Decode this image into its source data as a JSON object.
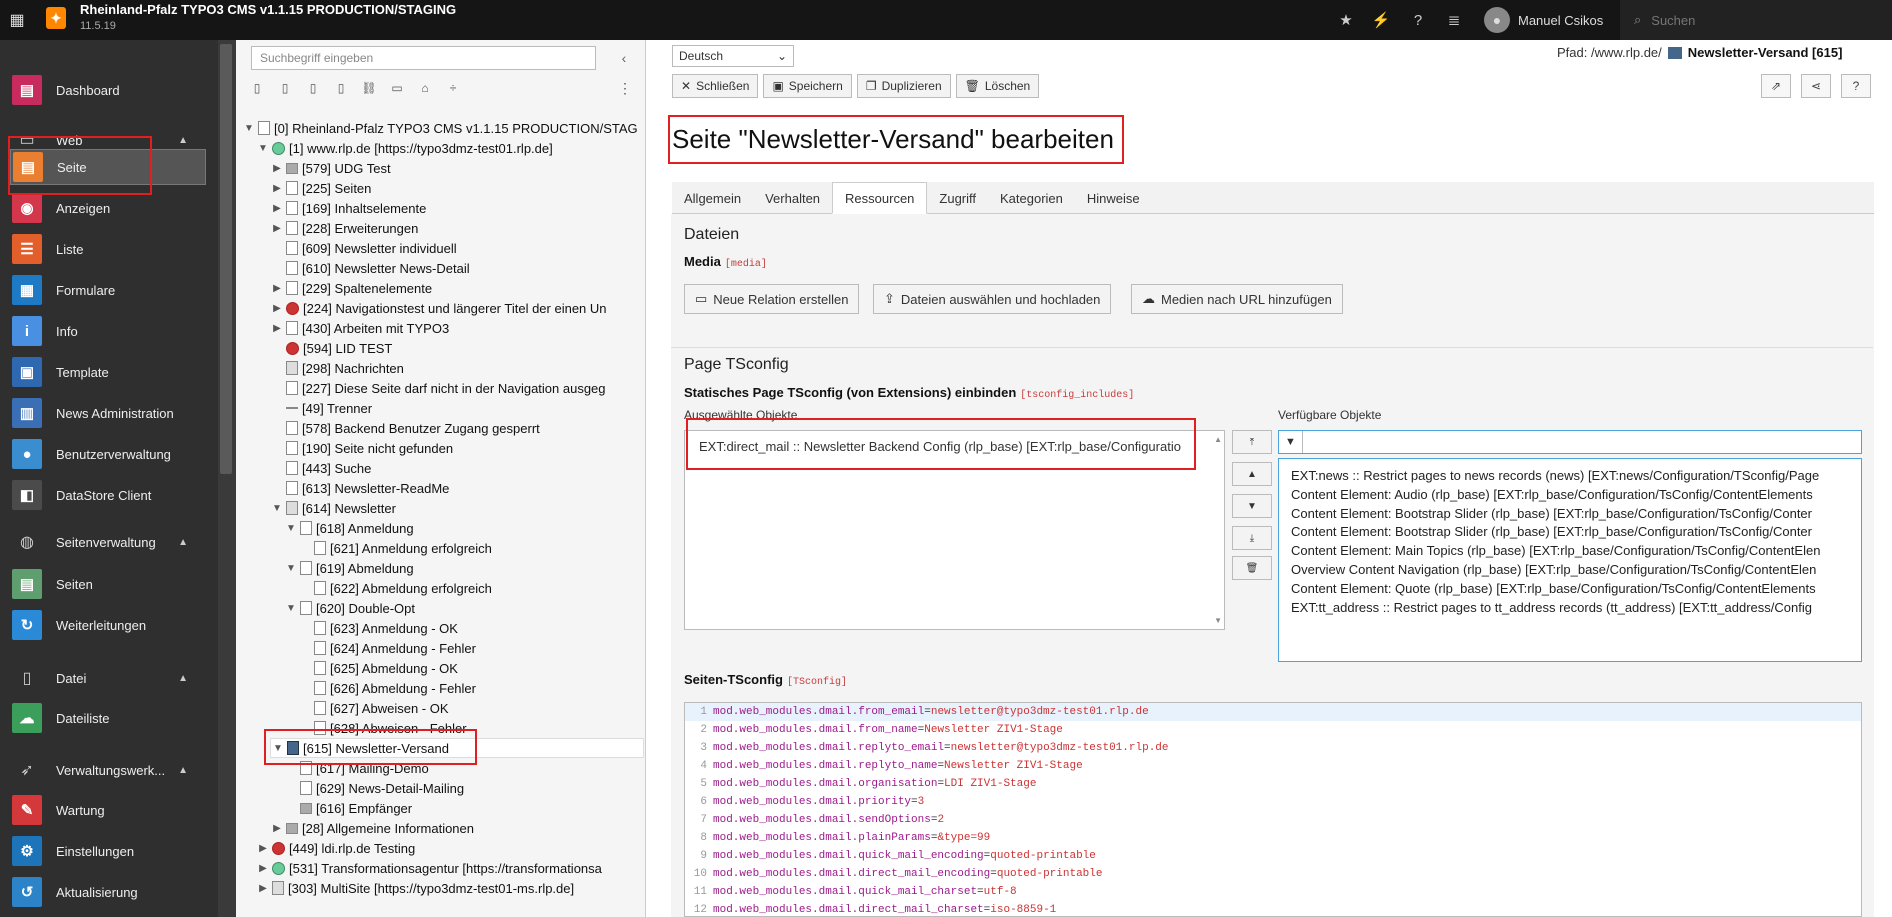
{
  "topbar": {
    "site_name": "Rheinland-Pfalz TYPO3 CMS v1.1.15 PRODUCTION/STAGING",
    "version": "11.5.19",
    "user_name": "Manuel Csikos",
    "search_placeholder": "Suchen"
  },
  "sidebar": {
    "dashboard": "Dashboard",
    "group_web": "Web",
    "web_items": [
      {
        "label": "Seite",
        "color": "#ea7f32",
        "icon": "page-module-icon"
      },
      {
        "label": "Anzeigen",
        "color": "#d4364c",
        "icon": "view-icon"
      },
      {
        "label": "Liste",
        "color": "#e25f2c",
        "icon": "list-icon"
      },
      {
        "label": "Formulare",
        "color": "#1f7ac5",
        "icon": "form-icon"
      },
      {
        "label": "Info",
        "color": "#4a90e2",
        "icon": "info-icon"
      },
      {
        "label": "Template",
        "color": "#2d68b1",
        "icon": "template-icon"
      },
      {
        "label": "News Administration",
        "color": "#3b6fb5",
        "icon": "news-icon"
      },
      {
        "label": "Benutzerverwaltung",
        "color": "#3a8ed0",
        "icon": "user-admin-icon"
      },
      {
        "label": "DataStore Client",
        "color": "#4b4b4b",
        "icon": "datastore-icon"
      }
    ],
    "group_seitenverwaltung": "Seitenverwaltung",
    "seitenverwaltung_items": [
      {
        "label": "Seiten",
        "color": "#5f9e6e",
        "icon": "pages-icon"
      },
      {
        "label": "Weiterleitungen",
        "color": "#2b8ad7",
        "icon": "redirect-icon"
      }
    ],
    "group_datei": "Datei",
    "datei_items": [
      {
        "label": "Dateiliste",
        "color": "#3b9e5a",
        "icon": "filelist-icon"
      }
    ],
    "group_verwaltung": "Verwaltungswerk...",
    "verwaltung_items": [
      {
        "label": "Wartung",
        "color": "#d4383a",
        "icon": "maintenance-icon"
      },
      {
        "label": "Einstellungen",
        "color": "#1e74b8",
        "icon": "settings-icon"
      },
      {
        "label": "Aktualisierung",
        "color": "#2c83c8",
        "icon": "upgrade-icon"
      }
    ]
  },
  "tree": {
    "search_placeholder": "Suchbegriff eingeben",
    "nodes": [
      {
        "label": "[0] Rheinland-Pfalz TYPO3 CMS v1.1.15 PRODUCTION/STAG",
        "arrow": "▼",
        "icon": "root"
      },
      {
        "label": "[1] www.rlp.de [https://typo3dmz-test01.rlp.de]",
        "arrow": "▼",
        "icon": "glob"
      },
      {
        "label": "[579] UDG Test",
        "arrow": "▶",
        "icon": "fold"
      },
      {
        "label": "[225] Seiten",
        "arrow": "▶",
        "icon": "page"
      },
      {
        "label": "[169] Inhaltselemente",
        "arrow": "▶",
        "icon": "page"
      },
      {
        "label": "[228] Erweiterungen",
        "arrow": "▶",
        "icon": "page"
      },
      {
        "label": "[609] Newsletter individuell",
        "arrow": "",
        "icon": "page"
      },
      {
        "label": "[610] Newsletter News-Detail",
        "arrow": "",
        "icon": "page"
      },
      {
        "label": "[229] Spaltenelemente",
        "arrow": "▶",
        "icon": "page"
      },
      {
        "label": "[224] Navigationstest und längerer Titel der einen Un",
        "arrow": "▶",
        "icon": "red"
      },
      {
        "label": "[430] Arbeiten mit TYPO3",
        "arrow": "▶",
        "icon": "page"
      },
      {
        "label": "[594] LID TEST",
        "arrow": "",
        "icon": "red"
      },
      {
        "label": "[298] Nachrichten",
        "arrow": "",
        "icon": "home"
      },
      {
        "label": "[227] Diese Seite darf nicht in der Navigation ausgeg",
        "arrow": "",
        "icon": "page"
      },
      {
        "label": "[49] Trenner",
        "arrow": "",
        "icon": "sep"
      },
      {
        "label": "[578] Backend Benutzer Zugang gesperrt",
        "arrow": "",
        "icon": "page"
      },
      {
        "label": "[190] Seite nicht gefunden",
        "arrow": "",
        "icon": "page"
      },
      {
        "label": "[443] Suche",
        "arrow": "",
        "icon": "page"
      },
      {
        "label": "[613] Newsletter-ReadMe",
        "arrow": "",
        "icon": "page"
      },
      {
        "label": "[614] Newsletter",
        "arrow": "▼",
        "icon": "home"
      },
      {
        "label": "[618] Anmeldung",
        "arrow": "▼",
        "icon": "page"
      },
      {
        "label": "[621] Anmeldung erfolgreich",
        "arrow": "",
        "icon": "page"
      },
      {
        "label": "[619] Abmeldung",
        "arrow": "▼",
        "icon": "page"
      },
      {
        "label": "[622] Abmeldung erfolgreich",
        "arrow": "",
        "icon": "page"
      },
      {
        "label": "[620] Double-Opt",
        "arrow": "▼",
        "icon": "page"
      },
      {
        "label": "[623] Anmeldung - OK",
        "arrow": "",
        "icon": "page"
      },
      {
        "label": "[624] Anmeldung - Fehler",
        "arrow": "",
        "icon": "page"
      },
      {
        "label": "[625] Abmeldung - OK",
        "arrow": "",
        "icon": "page"
      },
      {
        "label": "[626] Abmeldung - Fehler",
        "arrow": "",
        "icon": "page"
      },
      {
        "label": "[627] Abweisen - OK",
        "arrow": "",
        "icon": "page"
      },
      {
        "label": "[628] Abweisen - Fehler",
        "arrow": "",
        "icon": "page"
      },
      {
        "label": "[615] Newsletter-Versand",
        "arrow": "▼",
        "icon": "mail"
      },
      {
        "label": "[617] Mailing-Demo",
        "arrow": "",
        "icon": "page"
      },
      {
        "label": "[629] News-Detail-Mailing",
        "arrow": "",
        "icon": "page"
      },
      {
        "label": "[616] Empfänger",
        "arrow": "",
        "icon": "fold"
      },
      {
        "label": "[28] Allgemeine Informationen",
        "arrow": "▶",
        "icon": "fold"
      },
      {
        "label": "[449] ldi.rlp.de Testing",
        "arrow": "▶",
        "icon": "red"
      },
      {
        "label": "[531] Transformationsagentur [https://transformationsa",
        "arrow": "▶",
        "icon": "glob"
      },
      {
        "label": "[303] MultiSite [https://typo3dmz-test01-ms.rlp.de]",
        "arrow": "▶",
        "icon": "home"
      }
    ]
  },
  "doc": {
    "language": "Deutsch",
    "path_label": "Pfad: /www.rlp.de/",
    "path_page": "Newsletter-Versand [615]",
    "btn_close": "Schließen",
    "btn_save": "Speichern",
    "btn_duplicate": "Duplizieren",
    "btn_delete": "Löschen",
    "title": "Seite \"Newsletter-Versand\" bearbeiten",
    "tabs": [
      "Allgemein",
      "Verhalten",
      "Ressourcen",
      "Zugriff",
      "Kategorien",
      "Hinweise"
    ],
    "files_heading": "Dateien",
    "media_label": "Media",
    "media_code": "[media]",
    "btn_new_relation": "Neue Relation erstellen",
    "btn_select_upload": "Dateien auswählen und hochladen",
    "btn_media_url": "Medien nach URL hinzufügen",
    "tsconfig_heading": "Page TSconfig",
    "static_label": "Statisches Page TSconfig (von Extensions) einbinden",
    "static_code": "[tsconfig_includes]",
    "selected_label": "Ausgewählte Objekte",
    "available_label": "Verfügbare Objekte",
    "selected_items": [
      "EXT:direct_mail :: Newsletter Backend Config (rlp_base) [EXT:rlp_base/Configuratio"
    ],
    "available_items": [
      "EXT:news :: Restrict pages to news records (news) [EXT:news/Configuration/TSconfig/Page",
      "Content Element: Audio (rlp_base) [EXT:rlp_base/Configuration/TsConfig/ContentElements",
      "Content Element: Bootstrap Slider (rlp_base) [EXT:rlp_base/Configuration/TsConfig/Conter",
      "Content Element: Bootstrap Slider (rlp_base) [EXT:rlp_base/Configuration/TsConfig/Conter",
      "Content Element: Main Topics (rlp_base) [EXT:rlp_base/Configuration/TsConfig/ContentElen",
      "Overview Content Navigation (rlp_base) [EXT:rlp_base/Configuration/TsConfig/ContentElen",
      "Content Element: Quote (rlp_base) [EXT:rlp_base/Configuration/TsConfig/ContentElements",
      "EXT:tt_address :: Restrict pages to tt_address records (tt_address) [EXT:tt_address/Config"
    ],
    "seiten_label": "Seiten-TSconfig",
    "seiten_code": "[TSconfig]",
    "code_lines": [
      {
        "n": "1",
        "k": "mod.web_modules.dmail.from_email",
        "v": "newsletter@typo3dmz-test01.rlp.de"
      },
      {
        "n": "2",
        "k": "mod.web_modules.dmail.from_name",
        "v": "Newsletter ZIV1-Stage"
      },
      {
        "n": "3",
        "k": "mod.web_modules.dmail.replyto_email",
        "v": "newsletter@typo3dmz-test01.rlp.de"
      },
      {
        "n": "4",
        "k": "mod.web_modules.dmail.replyto_name",
        "v": "Newsletter ZIV1-Stage"
      },
      {
        "n": "5",
        "k": "mod.web_modules.dmail.organisation",
        "v": "LDI ZIV1-Stage"
      },
      {
        "n": "6",
        "k": "mod.web_modules.dmail.priority",
        "v": "3"
      },
      {
        "n": "7",
        "k": "mod.web_modules.dmail.sendOptions",
        "v": "2"
      },
      {
        "n": "8",
        "k": "mod.web_modules.dmail.plainParams",
        "v": "&type=99"
      },
      {
        "n": "9",
        "k": "mod.web_modules.dmail.quick_mail_encoding",
        "v": "quoted-printable"
      },
      {
        "n": "10",
        "k": "mod.web_modules.dmail.direct_mail_encoding",
        "v": "quoted-printable"
      },
      {
        "n": "11",
        "k": "mod.web_modules.dmail.quick_mail_charset",
        "v": "utf-8"
      },
      {
        "n": "12",
        "k": "mod.web_modules.dmail.direct_mail_charset",
        "v": "iso-8859-1"
      }
    ]
  }
}
